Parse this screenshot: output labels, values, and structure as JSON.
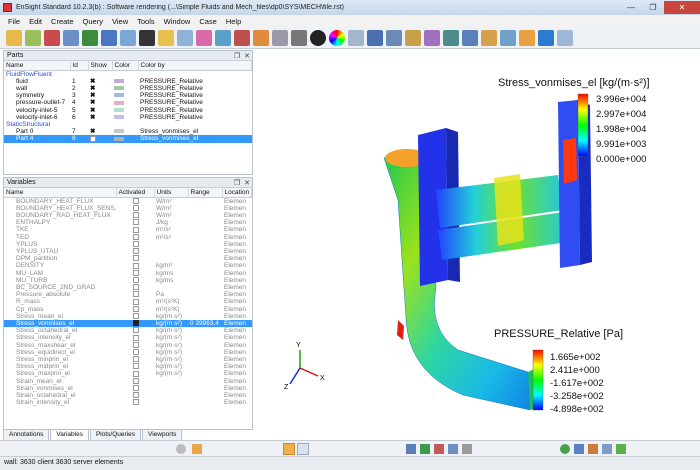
{
  "window": {
    "title": "EnSight Standard 10.2.3(b) : Software rendering (...\\Simple Fluids and Mech_files\\dp0\\SYS\\MECH\\file.rst)",
    "minimize": "—",
    "maximize": "❐",
    "close": "✕"
  },
  "menu": [
    "File",
    "Edit",
    "Create",
    "Query",
    "View",
    "Tools",
    "Window",
    "Case",
    "Help"
  ],
  "parts": {
    "title": "Parts",
    "columns": [
      "Name",
      "Id",
      "Show",
      "Color",
      "Color by"
    ],
    "rows": [
      {
        "name": "FluidFlowFluent",
        "id": "",
        "show": "",
        "color": "",
        "colorby": "",
        "group": true
      },
      {
        "name": "fluid",
        "id": "1",
        "show": "x",
        "color": "#c7a9d6",
        "colorby": "PRESSURE_Relative"
      },
      {
        "name": "wall",
        "id": "2",
        "show": "x",
        "color": "#a8c8a0",
        "colorby": "PRESSURE_Relative"
      },
      {
        "name": "symmetry",
        "id": "3",
        "show": "x",
        "color": "#a8b8e0",
        "colorby": "PRESSURE_Relative"
      },
      {
        "name": "pressure-outlet-7",
        "id": "4",
        "show": "x",
        "color": "#e0b0c8",
        "colorby": "PRESSURE_Relative"
      },
      {
        "name": "velocity-inlet-5",
        "id": "5",
        "show": "x",
        "color": "#b0e0d0",
        "colorby": "PRESSURE_Relative"
      },
      {
        "name": "velocity-inlet-6",
        "id": "6",
        "show": "x",
        "color": "#c0c0e8",
        "colorby": "PRESSURE_Relative"
      },
      {
        "name": "StaticStructural",
        "id": "",
        "show": "",
        "color": "",
        "colorby": "",
        "group": true
      },
      {
        "name": "Part 0",
        "id": "7",
        "show": "x",
        "color": "#c8c8c8",
        "colorby": "Stress_vonmises_el"
      },
      {
        "name": "Part 4",
        "id": "8",
        "show": "",
        "color": "#b0b0b0",
        "colorby": "Stress_vonmises_el",
        "selected": true
      }
    ]
  },
  "variables": {
    "title": "Variables",
    "columns": [
      "Name",
      "Activated",
      "Units",
      "Range",
      "Location"
    ],
    "rows": [
      {
        "name": "BOUNDARY_HEAT_FLUX",
        "units": "W/m²",
        "range": "",
        "loc": "Elemen"
      },
      {
        "name": "BOUNDARY_HEAT_FLUX_SENS...",
        "units": "W/m²",
        "range": "",
        "loc": "Elemen"
      },
      {
        "name": "BOUNDARY_RAD_HEAT_FLUX",
        "units": "W/m²",
        "range": "",
        "loc": "Elemen"
      },
      {
        "name": "ENTHALPY",
        "units": "J/kg",
        "range": "",
        "loc": "Elemen"
      },
      {
        "name": "TKE",
        "units": "m²/s²",
        "range": "",
        "loc": "Elemen"
      },
      {
        "name": "TED",
        "units": "m²/s³",
        "range": "",
        "loc": "Elemen"
      },
      {
        "name": "YPLUS",
        "units": "",
        "range": "",
        "loc": "Elemen"
      },
      {
        "name": "YPLUS_UTAU",
        "units": "",
        "range": "",
        "loc": "Elemen"
      },
      {
        "name": "DPM_partition",
        "units": "",
        "range": "",
        "loc": "Elemen"
      },
      {
        "name": "DENSITY",
        "units": "kg/m³",
        "range": "",
        "loc": "Elemen"
      },
      {
        "name": "MU_LAM",
        "units": "kg/ms",
        "range": "",
        "loc": "Elemen"
      },
      {
        "name": "MU_TURB",
        "units": "kg/ms",
        "range": "",
        "loc": "Elemen"
      },
      {
        "name": "BC_SOURCE_2ND_GRAD",
        "units": "",
        "range": "",
        "loc": "Elemen"
      },
      {
        "name": "Pressure_absolute",
        "units": "Pa",
        "range": "",
        "loc": "Elemen"
      },
      {
        "name": "R_mass",
        "units": "m²/(s²K)",
        "range": "",
        "loc": "Elemen"
      },
      {
        "name": "Cp_mass",
        "units": "m²/(s²K)",
        "range": "",
        "loc": "Elemen"
      },
      {
        "name": "Stress_mean_el",
        "units": "kg/(m·s²)",
        "range": "",
        "loc": "Elemen"
      },
      {
        "name": "Stress_vonmises_el",
        "units": "kg/(m·s²)",
        "range": "0  39963.4",
        "loc": "Elemen",
        "selected": true,
        "activated": true
      },
      {
        "name": "Stress_octahedral_el",
        "units": "kg/(m·s²)",
        "range": "",
        "loc": "Elemen"
      },
      {
        "name": "Stress_intensity_el",
        "units": "kg/(m·s²)",
        "range": "",
        "loc": "Elemen"
      },
      {
        "name": "Stress_maxshear_el",
        "units": "kg/(m·s²)",
        "range": "",
        "loc": "Elemen"
      },
      {
        "name": "Stress_equidirect_el",
        "units": "kg/(m·s²)",
        "range": "",
        "loc": "Elemen"
      },
      {
        "name": "Stress_minprin_el",
        "units": "kg/(m·s²)",
        "range": "",
        "loc": "Elemen"
      },
      {
        "name": "Stress_midprin_el",
        "units": "kg/(m·s²)",
        "range": "",
        "loc": "Elemen"
      },
      {
        "name": "Stress_maxprin_el",
        "units": "kg/(m·s²)",
        "range": "",
        "loc": "Elemen"
      },
      {
        "name": "Strain_mean_el",
        "units": "",
        "range": "",
        "loc": "Elemen"
      },
      {
        "name": "Strain_vonmises_el",
        "units": "",
        "range": "",
        "loc": "Elemen"
      },
      {
        "name": "Strain_octahedral_el",
        "units": "",
        "range": "",
        "loc": "Elemen"
      },
      {
        "name": "Strain_intensity_el",
        "units": "",
        "range": "",
        "loc": "Elemen"
      }
    ]
  },
  "tabs": [
    "Annotations",
    "Variables",
    "Plots/Queries",
    "Viewports"
  ],
  "legend_stress": {
    "title": "Stress_vonmises_el [kg/(m·s²)]",
    "values": [
      "3.996e+004",
      "2.997e+004",
      "1.998e+004",
      "9.991e+003",
      "0.000e+000"
    ]
  },
  "legend_pressure": {
    "title": "PRESSURE_Relative [Pa]",
    "values": [
      "1.665e+002",
      "2.411e+000",
      "-1.617e+002",
      "-3.258e+002",
      "-4.898e+002"
    ]
  },
  "axes": {
    "x": "X",
    "y": "Y",
    "z": "Z"
  },
  "status": "wall: 3630 client 3630 server elements",
  "colors": {
    "selection": "#3399ff",
    "group_text": "#2a4fc8",
    "close_red": "#c9463d"
  }
}
